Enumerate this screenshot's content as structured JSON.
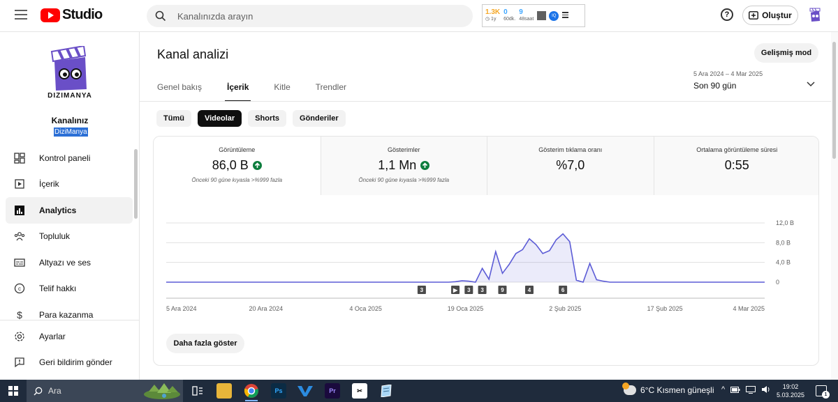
{
  "app": {
    "logo_text": "Studio",
    "search_placeholder": "Kanalınızda arayın",
    "create_label": "Oluştur"
  },
  "stats_widget": {
    "items": [
      {
        "top": "1.3K",
        "bottom": "1y",
        "color": "#f5a623"
      },
      {
        "top": "0",
        "bottom": "60dk.",
        "color": "#3ea6ff"
      },
      {
        "top": "9",
        "bottom": "48saat",
        "color": "#3ea6ff"
      }
    ],
    "badge": "IQ"
  },
  "sidebar": {
    "logo_text": "DIZIMANYA",
    "channel_label": "Kanalınız",
    "channel_name": "DiziManya",
    "items": [
      {
        "label": "Kontrol paneli",
        "icon": "dashboard-icon",
        "active": false
      },
      {
        "label": "İçerik",
        "icon": "content-icon",
        "active": false
      },
      {
        "label": "Analytics",
        "icon": "analytics-icon",
        "active": true
      },
      {
        "label": "Topluluk",
        "icon": "community-icon",
        "active": false
      },
      {
        "label": "Altyazı ve ses",
        "icon": "subtitles-icon",
        "active": false
      },
      {
        "label": "Telif hakkı",
        "icon": "copyright-icon",
        "active": false
      },
      {
        "label": "Para kazanma",
        "icon": "monetization-icon",
        "active": false
      }
    ],
    "bottom_items": [
      {
        "label": "Ayarlar",
        "icon": "settings-icon"
      },
      {
        "label": "Geri bildirim gönder",
        "icon": "feedback-icon"
      }
    ]
  },
  "main": {
    "title": "Kanal analizi",
    "advanced_mode": "Gelişmiş mod",
    "tabs": [
      {
        "label": "Genel bakış",
        "active": false
      },
      {
        "label": "İçerik",
        "active": true
      },
      {
        "label": "Kitle",
        "active": false
      },
      {
        "label": "Trendler",
        "active": false
      }
    ],
    "date_range": "5 Ara 2024 – 4 Mar 2025",
    "date_label": "Son 90 gün",
    "chips": [
      {
        "label": "Tümü",
        "active": false
      },
      {
        "label": "Videolar",
        "active": true
      },
      {
        "label": "Shorts",
        "active": false
      },
      {
        "label": "Gönderiler",
        "active": false
      }
    ],
    "metrics": [
      {
        "label": "Görüntüleme",
        "value": "86,0 B",
        "trend_up": true,
        "sub": "Önceki 90 güne kıyasla >%999 fazla",
        "active": true
      },
      {
        "label": "Gösterimler",
        "value": "1,1 Mn",
        "trend_up": true,
        "sub": "Önceki 90 güne kıyasla >%999 fazla",
        "active": false
      },
      {
        "label": "Gösterim tıklama oranı",
        "value": "%7,0",
        "trend_up": false,
        "sub": "",
        "active": false
      },
      {
        "label": "Ortalama görüntüleme süresi",
        "value": "0:55",
        "trend_up": false,
        "sub": "",
        "active": false
      }
    ],
    "show_more": "Daha fazla göster"
  },
  "chart_data": {
    "type": "area",
    "series": [
      {
        "values": [
          0,
          0,
          0,
          0,
          0,
          0,
          0,
          0,
          0,
          0,
          0,
          0,
          0,
          0,
          0,
          0,
          0,
          0,
          0,
          0,
          0,
          0,
          0,
          0,
          0,
          0,
          0,
          0,
          0,
          0,
          0,
          0,
          0,
          0,
          0,
          0,
          0,
          0,
          0,
          0,
          0,
          0,
          0,
          0.1,
          0.3,
          0.2,
          0,
          2.8,
          0.6,
          6.2,
          1.8,
          3.6,
          5.8,
          6.6,
          8.8,
          7.6,
          5.8,
          6.4,
          8.6,
          9.8,
          8.2,
          0.4,
          0,
          3.8,
          0.5,
          0.2,
          0,
          0,
          0,
          0,
          0,
          0,
          0,
          0,
          0,
          0,
          0,
          0,
          0,
          0,
          0,
          0,
          0,
          0,
          0,
          0,
          0,
          0,
          0,
          0
        ]
      }
    ],
    "yticks": [
      "0",
      "4,0 B",
      "8,0 B",
      "12,0 B"
    ],
    "ylim": [
      0,
      12
    ],
    "xticks": [
      "5 Ara 2024",
      "20 Ara 2024",
      "4 Oca 2025",
      "19 Oca 2025",
      "2 Şub 2025",
      "17 Şub 2025",
      "4 Mar 2025"
    ],
    "markers": [
      {
        "day": 38,
        "label": "3"
      },
      {
        "day": 43,
        "label": "▶"
      },
      {
        "day": 45,
        "label": "3"
      },
      {
        "day": 47,
        "label": "3"
      },
      {
        "day": 50,
        "label": "9"
      },
      {
        "day": 54,
        "label": "4"
      },
      {
        "day": 59,
        "label": "6"
      }
    ],
    "color": "#5c5cd6"
  },
  "taskbar": {
    "search_label": "Ara",
    "weather": "6°C  Kısmen güneşli",
    "time": "19:02",
    "date": "5.03.2025",
    "notif_count": "1"
  }
}
